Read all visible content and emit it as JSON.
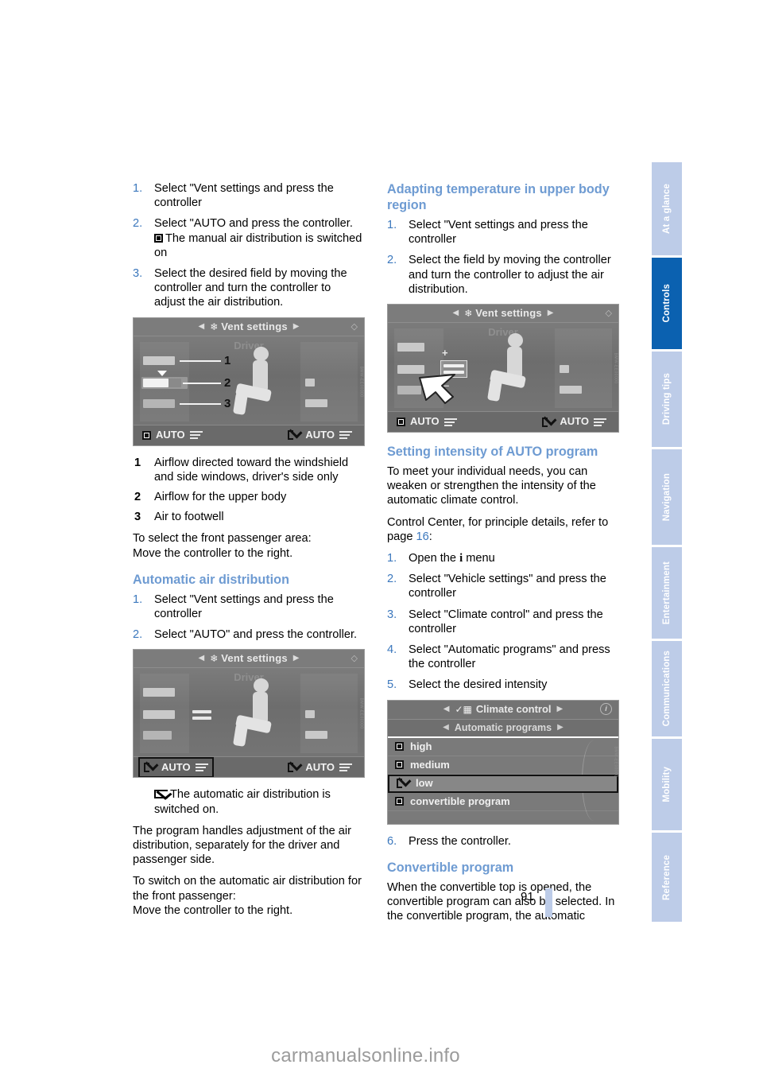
{
  "document": {
    "page_number": "91",
    "watermark": "carmanualsonline.info"
  },
  "sidebar": {
    "tabs": [
      {
        "label": "At a glance",
        "active": false
      },
      {
        "label": "Controls",
        "active": true
      },
      {
        "label": "Driving tips",
        "active": false
      },
      {
        "label": "Navigation",
        "active": false
      },
      {
        "label": "Entertainment",
        "active": false
      },
      {
        "label": "Communications",
        "active": false
      },
      {
        "label": "Mobility",
        "active": false
      },
      {
        "label": "Reference",
        "active": false
      }
    ],
    "active_color": "#0b61b0",
    "inactive_color": "#bdcce8"
  },
  "left_column": {
    "steps_manual": [
      {
        "num": "1.",
        "text": "Select \"Vent settings and press the controller"
      },
      {
        "num": "2.",
        "text": "Select \"AUTO and press the controller."
      },
      {
        "num": "3.",
        "text": "Select the desired field by moving the controller and turn the controller to adjust the air distribution."
      }
    ],
    "step2_note": "The manual air distribution is switched on",
    "display_manual": {
      "title": "Vent settings",
      "driver_label": "Driver",
      "auto_left": "AUTO",
      "auto_right": "AUTO",
      "callouts": [
        "1",
        "2",
        "3"
      ],
      "image_code": "BMW-EE00000"
    },
    "legend": [
      {
        "num": "1",
        "text": "Airflow directed toward the windshield and side windows, driver's side only"
      },
      {
        "num": "2",
        "text": "Airflow for the upper body"
      },
      {
        "num": "3",
        "text": "Air to footwell"
      }
    ],
    "front_passenger_note": "To select the front passenger area:\nMove the controller to the right.",
    "heading_auto_air": "Automatic air distribution",
    "steps_auto": [
      {
        "num": "1.",
        "text": "Select \"Vent settings and press the controller"
      },
      {
        "num": "2.",
        "text": "Select \"AUTO\" and press the controller."
      }
    ],
    "display_auto": {
      "title": "Vent settings",
      "driver_label": "Driver",
      "auto_left": "AUTO",
      "auto_right": "AUTO",
      "image_code": "BMW-EE00000"
    },
    "auto_on_note": "The automatic air distribution is switched on.",
    "paragraphs": [
      "The program handles adjustment of the air distribution, separately for the driver and passenger side.",
      "To switch on the automatic air distribution for the front passenger:\nMove the controller to the right."
    ]
  },
  "right_column": {
    "heading_adapting": "Adapting temperature in upper body region",
    "steps_adapting": [
      {
        "num": "1.",
        "text": "Select \"Vent settings and press the controller"
      },
      {
        "num": "2.",
        "text": "Select the field by moving the controller and turn the controller to adjust the air distribution."
      }
    ],
    "display_adapting": {
      "title": "Vent settings",
      "driver_label": "Driver",
      "plus": "+",
      "minus": "–",
      "auto_left": "AUTO",
      "auto_right": "AUTO",
      "image_code": "BMW-EE00000"
    },
    "heading_intensity": "Setting intensity of AUTO program",
    "intro_paragraphs": [
      "To meet your individual needs, you can weaken or strengthen the intensity of the automatic climate control."
    ],
    "control_center_line_a": "Control Center, for principle details, refer to page ",
    "control_center_page": "16",
    "control_center_line_b": ":",
    "steps_intensity": [
      {
        "num": "1.",
        "text": "Open the  menu",
        "icon": "i"
      },
      {
        "num": "2.",
        "text": "Select \"Vehicle settings\" and press the controller"
      },
      {
        "num": "3.",
        "text": "Select \"Climate control\" and press the controller"
      },
      {
        "num": "4.",
        "text": "Select \"Automatic programs\" and press the controller"
      },
      {
        "num": "5.",
        "text": "Select the desired intensity"
      }
    ],
    "display_climate": {
      "header_title": "Climate control",
      "sub_title": "Automatic programs",
      "items": [
        {
          "label": "high",
          "selected": false,
          "checked": false
        },
        {
          "label": "medium",
          "selected": false,
          "checked": false
        },
        {
          "label": "low",
          "selected": true,
          "checked": true
        },
        {
          "label": "convertible program",
          "selected": false,
          "checked": false
        }
      ],
      "image_code": "BMW-EE00000"
    },
    "step6": {
      "num": "6.",
      "text": "Press the controller."
    },
    "heading_convertible": "Convertible program",
    "convertible_paragraph": "When the convertible top is opened, the convertible program can also be selected. In the convertible program, the automatic"
  }
}
